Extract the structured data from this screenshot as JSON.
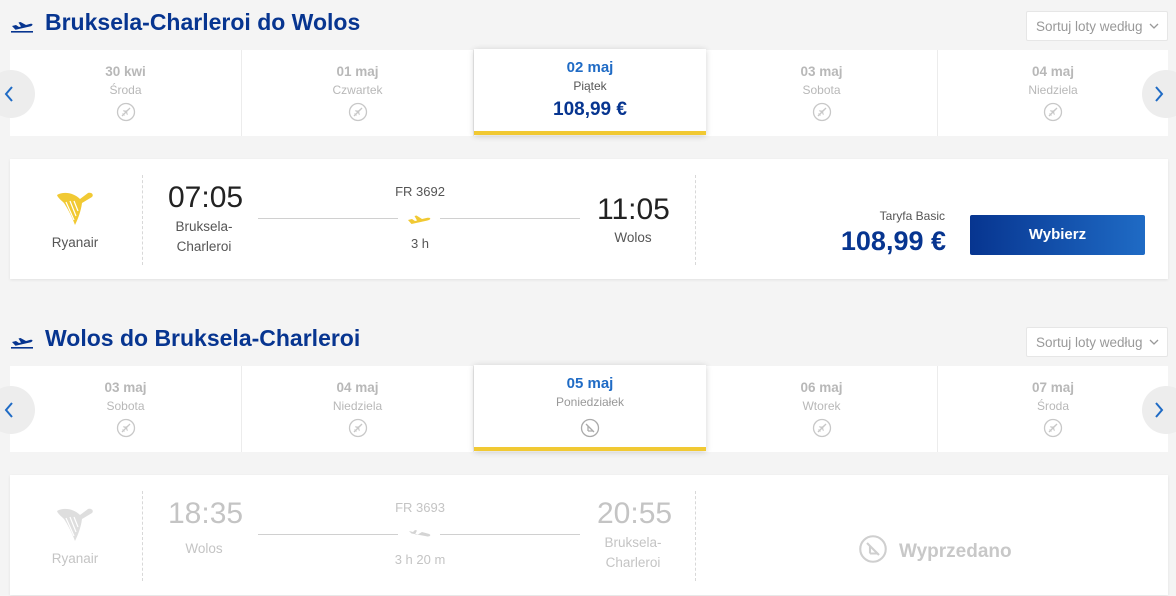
{
  "outbound": {
    "title": "Bruksela-Charleroi do Wolos",
    "sort_label": "Sortuj loty według",
    "dates": [
      {
        "date": "30 kwi",
        "day": "Środa",
        "icon": "no-flight-icon"
      },
      {
        "date": "01 maj",
        "day": "Czwartek",
        "icon": "no-flight-icon"
      },
      {
        "date": "02 maj",
        "day": "Piątek",
        "price": "108,99 €",
        "selected": true
      },
      {
        "date": "03 maj",
        "day": "Sobota",
        "icon": "no-flight-icon"
      },
      {
        "date": "04 maj",
        "day": "Niedziela",
        "icon": "no-flight-icon"
      }
    ],
    "flight": {
      "airline": "Ryanair",
      "dep_time": "07:05",
      "dep_city": "Bruksela-Charleroi",
      "flight_no": "FR 3692",
      "duration": "3 h",
      "arr_time": "11:05",
      "arr_city": "Wolos",
      "fare_name": "Taryfa Basic",
      "price": "108,99 €",
      "select_label": "Wybierz"
    }
  },
  "return": {
    "title": "Wolos do Bruksela-Charleroi",
    "sort_label": "Sortuj loty według",
    "dates": [
      {
        "date": "03 maj",
        "day": "Sobota",
        "icon": "no-flight-icon"
      },
      {
        "date": "04 maj",
        "day": "Niedziela",
        "icon": "no-flight-icon"
      },
      {
        "date": "05 maj",
        "day": "Poniedziałek",
        "icon": "sold-out-icon",
        "selected": true
      },
      {
        "date": "06 maj",
        "day": "Wtorek",
        "icon": "no-flight-icon"
      },
      {
        "date": "07 maj",
        "day": "Środa",
        "icon": "no-flight-icon"
      }
    ],
    "flight": {
      "airline": "Ryanair",
      "dep_time": "18:35",
      "dep_city": "Wolos",
      "flight_no": "FR 3693",
      "duration": "3 h 20 m",
      "arr_time": "20:55",
      "arr_city": "Bruksela-Charleroi",
      "status": "Wyprzedano"
    }
  },
  "colors": {
    "brand_blue": "#073590",
    "accent_blue": "#1f6bc5",
    "yellow": "#f1c933"
  }
}
